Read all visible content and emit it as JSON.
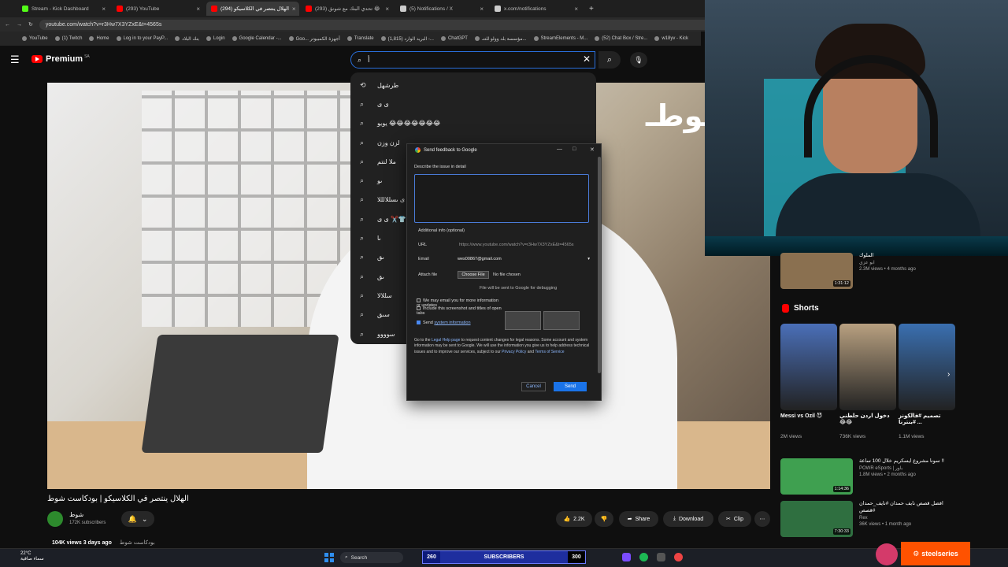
{
  "browser": {
    "tabs": [
      {
        "title": "Stream - Kick Dashboard",
        "color": "#53fc18",
        "active": false
      },
      {
        "title": "(293) YouTube",
        "color": "#ff0000",
        "active": false
      },
      {
        "title": "(294) الهلال ينتصر في الكلاسيكو",
        "color": "#ff0000",
        "active": true
      },
      {
        "title": "(293) تحدي البنك مع شونق 😂",
        "color": "#ff0000",
        "active": false
      },
      {
        "title": "(5) Notifications / X",
        "color": "#cccccc",
        "active": false
      },
      {
        "title": "x.com/notifications",
        "color": "#cccccc",
        "active": false
      }
    ],
    "new_tab": "+",
    "url": "youtube.com/watch?v=r3Hw7X3YZxE&t=4565s",
    "bookmarks": [
      "YouTube",
      "(1) Twitch",
      "Home",
      "Log in to your PayP...",
      "بنك البلاد",
      "Login",
      "Google Calendar -...",
      "Goo... أجهزة الكمبيوتر",
      "Translate",
      "البريد الوارد (1,815) -...",
      "ChatGPT",
      "مؤسسة بلد وولو للتنـ...",
      "StreamElements - M...",
      "(52) Chat Box / Stre...",
      "w18yv - Kick"
    ]
  },
  "yt": {
    "brand": "Premium",
    "region": "SA",
    "menu_icon": "☰",
    "search_value": "أ",
    "clear_icon": "✕",
    "search_icon": "⌕",
    "mic_icon": "🎙",
    "suggestions": [
      {
        "icon": "history",
        "text": "طرشهل"
      },
      {
        "icon": "search",
        "text": "ى ى"
      },
      {
        "icon": "search",
        "text": "يويو 😂😂😂😂😂😂😂"
      },
      {
        "icon": "search",
        "text": "لزن وزن"
      },
      {
        "icon": "search",
        "text": "ملا لنتم"
      },
      {
        "icon": "search",
        "text": "ىو"
      },
      {
        "icon": "search",
        "text": "ى ى ىسللالللا"
      },
      {
        "icon": "search",
        "text": "ى ى ✂️👕"
      },
      {
        "icon": "search",
        "text": "ىا"
      },
      {
        "icon": "search",
        "text": "ىق"
      },
      {
        "icon": "search",
        "text": "ىق"
      },
      {
        "icon": "search",
        "text": "سللالا"
      },
      {
        "icon": "search",
        "text": "سىق"
      },
      {
        "icon": "search",
        "text": "سوووو"
      }
    ],
    "video": {
      "overlay_text": "ـوطـ",
      "title": "الهلال ينتصر في الكلاسيكو | بودكاست شوط",
      "channel": "شوط",
      "subscribers": "172K subscribers",
      "bell": "🔔",
      "likes": "2.2K",
      "share": "Share",
      "download": "Download",
      "clip": "Clip",
      "more": "⋯",
      "views": "104K views",
      "age": "3 days ago",
      "tag": "بودكاست شوط"
    },
    "sidebar": {
      "top_video": {
        "title": "الملوك",
        "channel": "ابو عزي",
        "meta": "2.3M views • 4 months ago",
        "duration": "1:31:12"
      },
      "shorts_title": "Shorts",
      "shorts": [
        {
          "title": "Messi vs Ozil 😈",
          "views": "2M views",
          "color": "#4a6fb8"
        },
        {
          "title": "دخول اردن حلطني 😂😂",
          "views": "736K views",
          "color": "#b8a080"
        },
        {
          "title": "تصميم #فالكونز #بنترنا ...",
          "views": "1.1M views",
          "color": "#3a6fb0"
        }
      ],
      "videos": [
        {
          "title": "سونا مشروع ايسكريم خلال 100 ساعة !!",
          "channel": "POWR eSports | باور",
          "meta": "1.8M views • 2 months ago",
          "duration": "1:14:36",
          "color": "#3fa050"
        },
        {
          "title": "افضل قصص نايف حمدان #نايف_حمدان #قصص",
          "channel": "Rex",
          "meta": "36K views • 1 month ago",
          "duration": "7:30:33",
          "color": "#2f6f40"
        }
      ]
    }
  },
  "feedback": {
    "title": "Send feedback to Google",
    "describe_label": "Describe the issue in detail",
    "additional_label": "Additional info (optional)",
    "url_label": "URL",
    "url_value": "https://www.youtube.com/watch?v=r3Hw7X3YZxE&t=4565s",
    "email_label": "Email",
    "email_value": "wes00867@gmail.com",
    "attach_label": "Attach file",
    "choose_file": "Choose File",
    "no_file": "No file chosen",
    "debug_note": "File will be sent to Google for debugging",
    "opt1": "We may email you for more information or updates",
    "opt2": "Include this screenshot and titles of open tabs",
    "opt3_prefix": "Send",
    "opt3_link": "system information",
    "legal_1": "Go to the",
    "legal_link1": "Legal Help page",
    "legal_2": "to request content changes for legal reasons. Some account and system information may be sent to Google. We will use the information you give us to help address technical issues and to improve our services, subject to our",
    "legal_link2": "Privacy Policy",
    "legal_3": "and",
    "legal_link3": "Terms of Service",
    "cancel": "Cancel",
    "send": "Send"
  },
  "taskbar": {
    "temp": "22°C",
    "weather": "سماء صافية",
    "search": "Search",
    "subs_left": "260",
    "subs_label": "SUBSCRIBERS",
    "subs_right": "300",
    "sponsor": "steelseries"
  }
}
